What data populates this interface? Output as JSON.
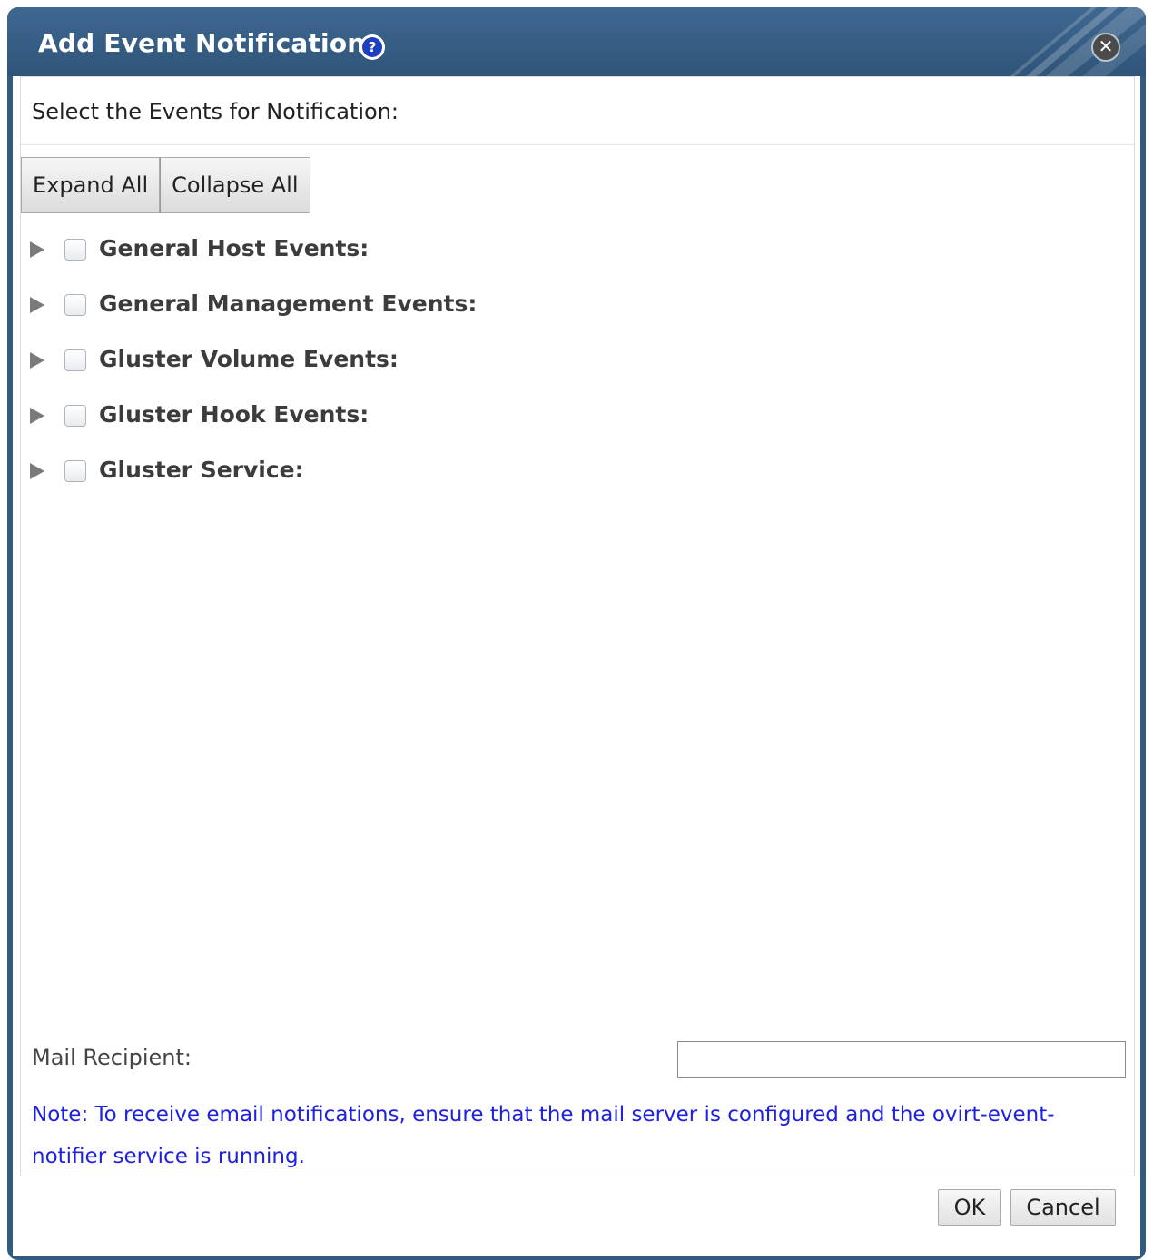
{
  "dialog": {
    "title": "Add Event Notification",
    "help_icon": "question-circle-icon",
    "help_glyph": "?",
    "close_icon": "close-circle-icon",
    "close_glyph": "✕",
    "colors": {
      "header": "#335a7f",
      "note_text": "#1f21e0"
    }
  },
  "content": {
    "instruction": "Select the Events for Notification:",
    "expand_all_label": "Expand All",
    "collapse_all_label": "Collapse All",
    "event_groups": [
      {
        "label": "General Host Events:",
        "checked": false,
        "expanded": false
      },
      {
        "label": "General Management Events:",
        "checked": false,
        "expanded": false
      },
      {
        "label": "Gluster Volume Events:",
        "checked": false,
        "expanded": false
      },
      {
        "label": "Gluster Hook Events:",
        "checked": false,
        "expanded": false
      },
      {
        "label": "Gluster Service:",
        "checked": false,
        "expanded": false
      }
    ],
    "mail_recipient_label": "Mail Recipient:",
    "mail_recipient_value": "",
    "note": "Note: To receive email notifications, ensure that the mail server is configured and the ovirt-event-notifier service is running."
  },
  "footer": {
    "ok_label": "OK",
    "cancel_label": "Cancel"
  }
}
